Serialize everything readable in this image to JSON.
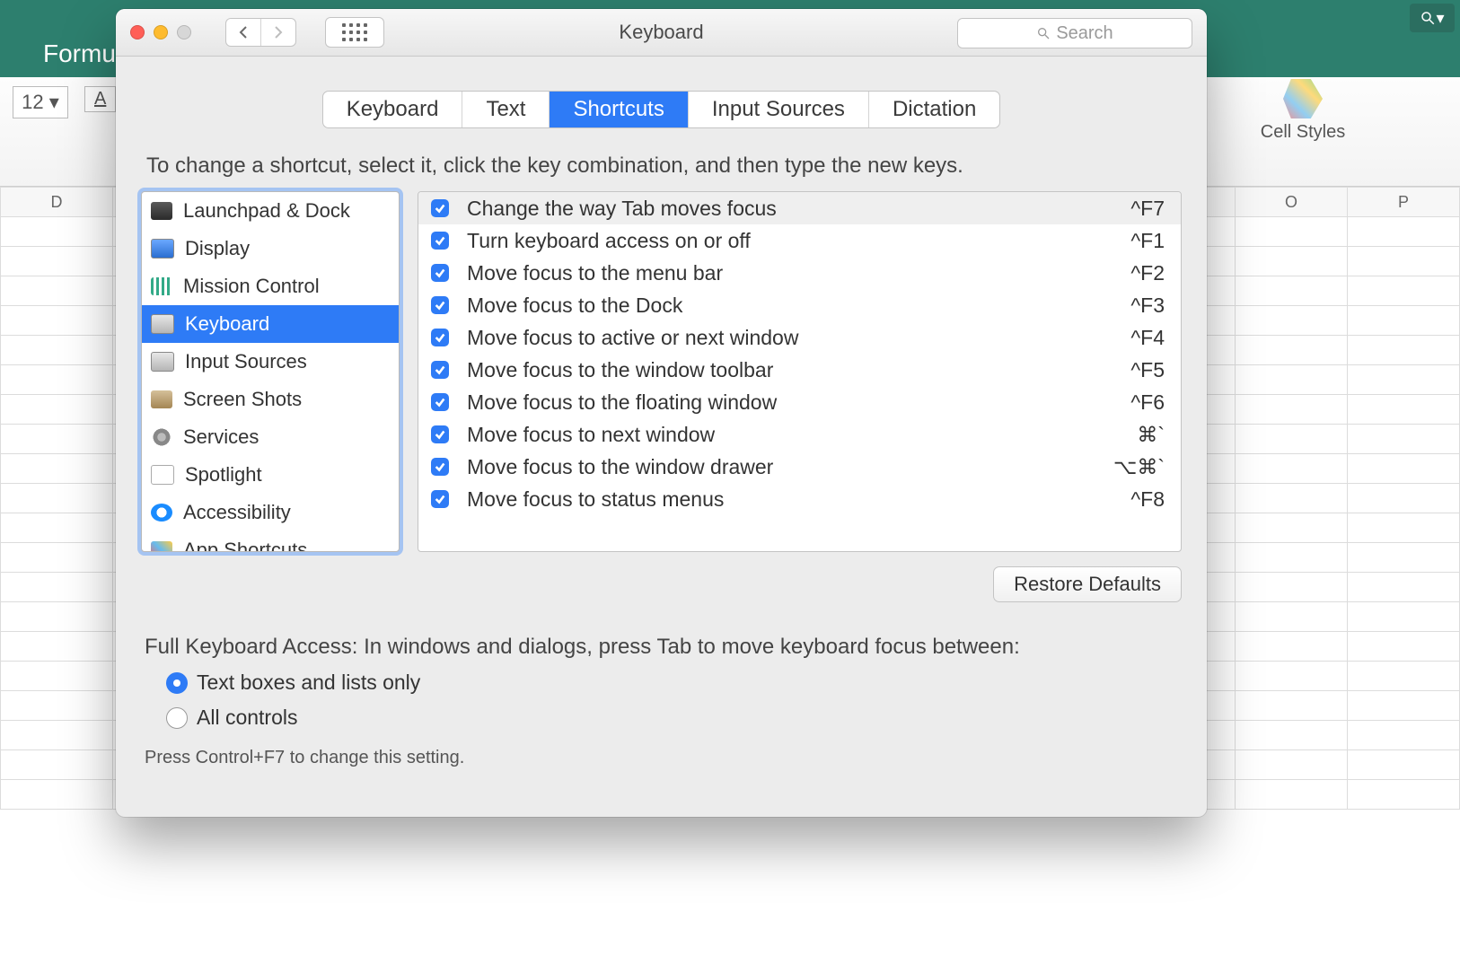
{
  "window": {
    "title": "Keyboard",
    "search_placeholder": "Search"
  },
  "tabs": [
    {
      "label": "Keyboard",
      "selected": false
    },
    {
      "label": "Text",
      "selected": false
    },
    {
      "label": "Shortcuts",
      "selected": true
    },
    {
      "label": "Input Sources",
      "selected": false
    },
    {
      "label": "Dictation",
      "selected": false
    }
  ],
  "instruction": "To change a shortcut, select it, click the key combination, and then type the new keys.",
  "categories": [
    {
      "label": "Launchpad & Dock",
      "icon": "ico-generic"
    },
    {
      "label": "Display",
      "icon": "ico-display"
    },
    {
      "label": "Mission Control",
      "icon": "ico-mission"
    },
    {
      "label": "Keyboard",
      "icon": "ico-keyboard",
      "selected": true
    },
    {
      "label": "Input Sources",
      "icon": "ico-input"
    },
    {
      "label": "Screen Shots",
      "icon": "ico-camera"
    },
    {
      "label": "Services",
      "icon": "ico-gear"
    },
    {
      "label": "Spotlight",
      "icon": "ico-doc"
    },
    {
      "label": "Accessibility",
      "icon": "ico-access"
    },
    {
      "label": "App Shortcuts",
      "icon": "ico-app"
    }
  ],
  "shortcuts": [
    {
      "label": "Change the way Tab moves focus",
      "key": "^F7",
      "checked": true,
      "selected": true
    },
    {
      "label": "Turn keyboard access on or off",
      "key": "^F1",
      "checked": true
    },
    {
      "label": "Move focus to the menu bar",
      "key": "^F2",
      "checked": true
    },
    {
      "label": "Move focus to the Dock",
      "key": "^F3",
      "checked": true
    },
    {
      "label": "Move focus to active or next window",
      "key": "^F4",
      "checked": true
    },
    {
      "label": "Move focus to the window toolbar",
      "key": "^F5",
      "checked": true
    },
    {
      "label": "Move focus to the floating window",
      "key": "^F6",
      "checked": true
    },
    {
      "label": "Move focus to next window",
      "key": "⌘`",
      "checked": true
    },
    {
      "label": "Move focus to the window drawer",
      "key": "⌥⌘`",
      "checked": true
    },
    {
      "label": "Move focus to status menus",
      "key": "^F8",
      "checked": true
    }
  ],
  "restore": "Restore Defaults",
  "access": {
    "intro": "Full Keyboard Access: In windows and dialogs, press Tab to move keyboard focus between:",
    "options": [
      {
        "label": "Text boxes and lists only",
        "checked": true
      },
      {
        "label": "All controls",
        "checked": false
      }
    ],
    "hint": "Press Control+F7 to change this setting."
  },
  "excel": {
    "tab": "Formula",
    "font_size": "12",
    "underline_label": "A",
    "cell_styles": "Cell Styles",
    "col_d": "D",
    "col_o": "O",
    "col_p": "P"
  }
}
